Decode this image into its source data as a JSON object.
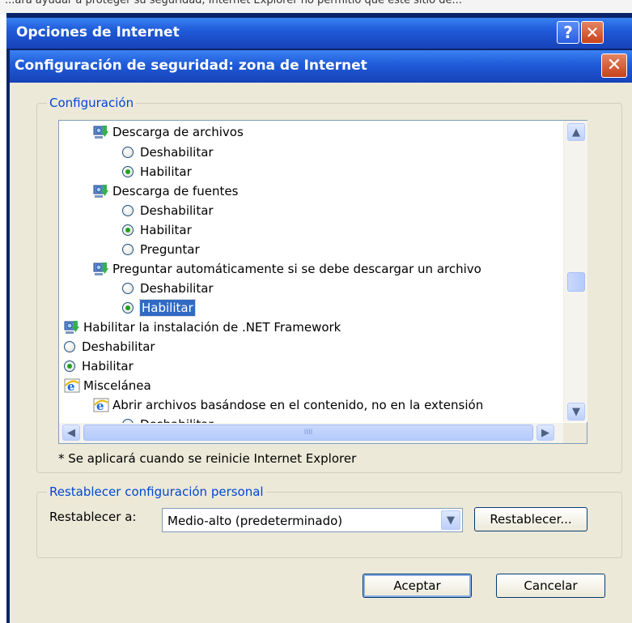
{
  "background_text": "...ara ayudar a proteger su seguridad, Internet Explorer no permitió que este sitio de...",
  "outer_window": {
    "title": "Opciones de Internet",
    "help_label": "?",
    "close_label": "✕"
  },
  "dialog": {
    "title": "Configuración de seguridad: zona de Internet",
    "close_label": "✕"
  },
  "settings_group": {
    "legend": "Configuración"
  },
  "settings_list": {
    "rows": [
      {
        "kind": "header",
        "icon": "download-settings-icon",
        "label": "Descarga de archivos"
      },
      {
        "kind": "option",
        "label": "Deshabilitar",
        "checked": false
      },
      {
        "kind": "option",
        "label": "Habilitar",
        "checked": true
      },
      {
        "kind": "header",
        "icon": "download-settings-icon",
        "label": "Descarga de fuentes"
      },
      {
        "kind": "option",
        "label": "Deshabilitar",
        "checked": false
      },
      {
        "kind": "option",
        "label": "Habilitar",
        "checked": true
      },
      {
        "kind": "option",
        "label": "Preguntar",
        "checked": false
      },
      {
        "kind": "header",
        "icon": "download-settings-icon",
        "label": "Preguntar automáticamente si se debe descargar un archivo"
      },
      {
        "kind": "option",
        "label": "Deshabilitar",
        "checked": false
      },
      {
        "kind": "option",
        "label": "Habilitar",
        "checked": true,
        "selected": true
      },
      {
        "kind": "header",
        "icon": "download-settings-icon",
        "label": "Habilitar la instalación de .NET Framework"
      },
      {
        "kind": "option",
        "label": "Deshabilitar",
        "checked": false
      },
      {
        "kind": "option",
        "label": "Habilitar",
        "checked": true
      },
      {
        "kind": "header",
        "icon": "internet-explorer-icon",
        "label": "Miscelánea"
      },
      {
        "kind": "header",
        "icon": "internet-explorer-icon",
        "label": "Abrir archivos basándose en el contenido, no en la extensión"
      },
      {
        "kind": "option",
        "label": "Deshabilitar",
        "checked": false
      }
    ]
  },
  "scrollbar": {
    "up": "▲",
    "down": "▼",
    "left": "◀",
    "right": "▶",
    "grip": "IIII"
  },
  "restart_note": "* Se aplicará cuando se reinicie Internet Explorer",
  "reset_group": {
    "legend": "Restablecer configuración personal",
    "label": "Restablecer a:",
    "selected_value": "Medio-alto (predeterminado)",
    "dropdown_arrow": "▼",
    "reset_button": "Restablecer..."
  },
  "buttons": {
    "ok": "Aceptar",
    "cancel": "Cancelar"
  },
  "colors": {
    "title_bar": "#1f5bd8",
    "dialog_bg": "#ece9d8",
    "selection": "#316ac5",
    "legend_text": "#0046d5"
  }
}
